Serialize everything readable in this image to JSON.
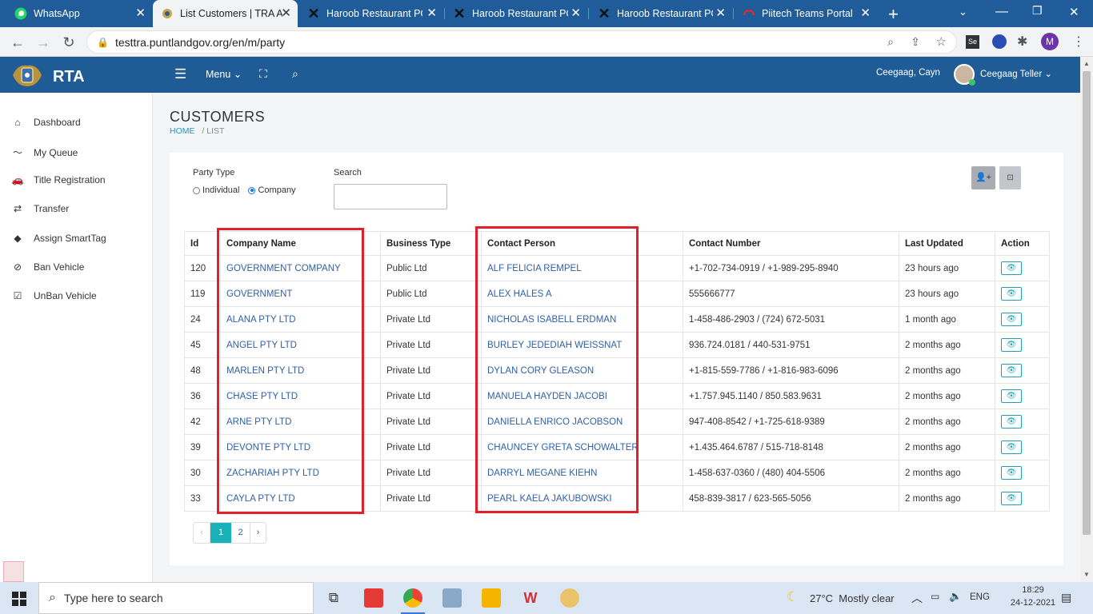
{
  "browser": {
    "tabs": [
      {
        "title": "WhatsApp",
        "icon": "whatsapp-icon"
      },
      {
        "title": "List Customers | TRA A",
        "icon": "rta-logo-icon",
        "active": true
      },
      {
        "title": "Haroob Restaurant PC",
        "icon": "x-logo-icon"
      },
      {
        "title": "Haroob Restaurant PC",
        "icon": "x-logo-icon"
      },
      {
        "title": "Haroob Restaurant PC",
        "icon": "x-logo-icon"
      },
      {
        "title": "Piitech Teams Portal",
        "icon": "headset-icon"
      }
    ],
    "url": "testtra.puntlandgov.org/en/m/party",
    "profile_initial": "M"
  },
  "app": {
    "brand": "RTA",
    "menu_label": "Menu",
    "user_location": "Ceegaag, Cayn",
    "user_name": "Ceegaag Teller"
  },
  "sidebar": {
    "items": [
      {
        "label": "Dashboard",
        "icon": "home-icon"
      },
      {
        "label": "My Queue",
        "icon": "trend-icon"
      },
      {
        "label": "Title Registration",
        "icon": "car-icon"
      },
      {
        "label": "Transfer",
        "icon": "transfer-icon"
      },
      {
        "label": "Assign SmartTag",
        "icon": "tag-icon"
      },
      {
        "label": "Ban Vehicle",
        "icon": "ban-icon"
      },
      {
        "label": "UnBan Vehicle",
        "icon": "check-square-icon"
      }
    ]
  },
  "page": {
    "title": "CUSTOMERS",
    "breadcrumb_home": "HOME",
    "breadcrumb_current": "/ LIST"
  },
  "filters": {
    "party_type_label": "Party Type",
    "option_individual": "Individual",
    "option_company": "Company",
    "selected": "Company",
    "search_label": "Search",
    "search_value": ""
  },
  "table": {
    "headers": [
      "Id",
      "Company Name",
      "Business Type",
      "Contact Person",
      "Contact Number",
      "Last Updated",
      "Action"
    ],
    "rows": [
      {
        "id": "120",
        "company": "GOVERNMENT COMPANY",
        "type": "Public Ltd",
        "contact": "ALF FELICIA REMPEL",
        "phone": "+1-702-734-0919 / +1-989-295-8940",
        "updated": "23 hours ago"
      },
      {
        "id": "119",
        "company": "GOVERNMENT",
        "type": "Public Ltd",
        "contact": "ALEX HALES A",
        "phone": "555666777",
        "updated": "23 hours ago"
      },
      {
        "id": "24",
        "company": "ALANA PTY LTD",
        "type": "Private Ltd",
        "contact": "NICHOLAS ISABELL ERDMAN",
        "phone": "1-458-486-2903 / (724) 672-5031",
        "updated": "1 month ago"
      },
      {
        "id": "45",
        "company": "ANGEL PTY LTD",
        "type": "Private Ltd",
        "contact": "BURLEY JEDEDIAH WEISSNAT",
        "phone": "936.724.0181 / 440-531-9751",
        "updated": "2 months ago"
      },
      {
        "id": "48",
        "company": "MARLEN PTY LTD",
        "type": "Private Ltd",
        "contact": "DYLAN CORY GLEASON",
        "phone": "+1-815-559-7786 / +1-816-983-6096",
        "updated": "2 months ago"
      },
      {
        "id": "36",
        "company": "CHASE PTY LTD",
        "type": "Private Ltd",
        "contact": "MANUELA HAYDEN JACOBI",
        "phone": "+1.757.945.1140 / 850.583.9631",
        "updated": "2 months ago"
      },
      {
        "id": "42",
        "company": "ARNE PTY LTD",
        "type": "Private Ltd",
        "contact": "DANIELLA ENRICO JACOBSON",
        "phone": "947-408-8542 / +1-725-618-9389",
        "updated": "2 months ago"
      },
      {
        "id": "39",
        "company": "DEVONTE PTY LTD",
        "type": "Private Ltd",
        "contact": "CHAUNCEY GRETA SCHOWALTER",
        "phone": "+1.435.464.6787 / 515-718-8148",
        "updated": "2 months ago"
      },
      {
        "id": "30",
        "company": "ZACHARIAH PTY LTD",
        "type": "Private Ltd",
        "contact": "DARRYL MEGANE KIEHN",
        "phone": "1-458-637-0360 / (480) 404-5506",
        "updated": "2 months ago"
      },
      {
        "id": "33",
        "company": "CAYLA PTY LTD",
        "type": "Private Ltd",
        "contact": "PEARL KAELA JAKUBOWSKI",
        "phone": "458-839-3817 / 623-565-5056",
        "updated": "2 months ago"
      }
    ]
  },
  "pagination": {
    "prev": "‹",
    "pages": [
      "1",
      "2"
    ],
    "current": "1",
    "next": "›"
  },
  "taskbar": {
    "search_placeholder": "Type here to search",
    "weather_temp": "27°C",
    "weather_desc": "Mostly clear",
    "language": "ENG",
    "time": "18:29",
    "date": "24-12-2021"
  },
  "colors": {
    "header_blue": "#1f5b94",
    "link_blue": "#2d5fa6",
    "teal": "#17a2b8",
    "highlight_red": "#e0202b"
  }
}
